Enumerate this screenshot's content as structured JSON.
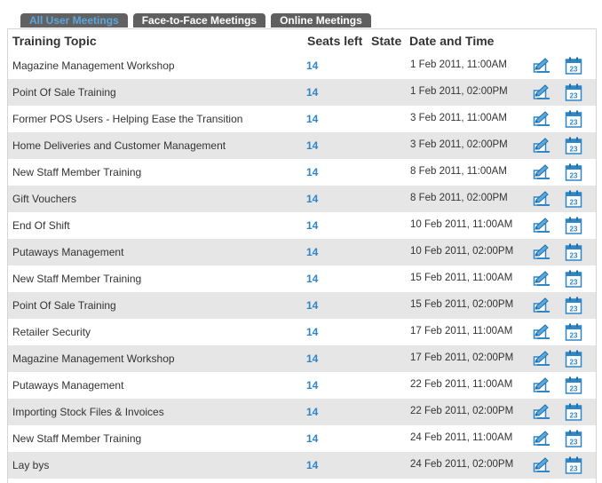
{
  "tabs": [
    {
      "label": "All User Meetings",
      "active": true
    },
    {
      "label": "Face-to-Face Meetings",
      "active": false
    },
    {
      "label": "Online Meetings",
      "active": false
    }
  ],
  "columns": {
    "topic": "Training Topic",
    "seats": "Seats left",
    "state": "State",
    "date": "Date and Time"
  },
  "icons": {
    "edit": "edit-pencil-icon",
    "calendar": "calendar-icon",
    "calendar_day": "23"
  },
  "colors": {
    "accent": "#2f86c6",
    "tab_bg": "#5f5f5f",
    "row_alt": "#e6e6e6"
  },
  "rows": [
    {
      "topic": "Magazine Management Workshop",
      "seats": "14",
      "state": "",
      "date": "1 Feb 2011, 11:00AM"
    },
    {
      "topic": "Point Of Sale Training",
      "seats": "14",
      "state": "",
      "date": "1 Feb 2011, 02:00PM"
    },
    {
      "topic": "Former POS Users - Helping Ease the Transition",
      "seats": "14",
      "state": "",
      "date": "3 Feb 2011, 11:00AM"
    },
    {
      "topic": "Home Deliveries and Customer Management",
      "seats": "14",
      "state": "",
      "date": "3 Feb 2011, 02:00PM"
    },
    {
      "topic": "New Staff Member Training",
      "seats": "14",
      "state": "",
      "date": "8 Feb 2011, 11:00AM"
    },
    {
      "topic": "Gift Vouchers",
      "seats": "14",
      "state": "",
      "date": "8 Feb 2011, 02:00PM"
    },
    {
      "topic": "End Of Shift",
      "seats": "14",
      "state": "",
      "date": "10 Feb 2011, 11:00AM"
    },
    {
      "topic": "Putaways Management",
      "seats": "14",
      "state": "",
      "date": "10 Feb 2011, 02:00PM"
    },
    {
      "topic": "New Staff Member Training",
      "seats": "14",
      "state": "",
      "date": "15 Feb 2011, 11:00AM"
    },
    {
      "topic": "Point Of Sale Training",
      "seats": "14",
      "state": "",
      "date": "15 Feb 2011, 02:00PM"
    },
    {
      "topic": "Retailer Security",
      "seats": "14",
      "state": "",
      "date": "17 Feb 2011, 11:00AM"
    },
    {
      "topic": "Magazine Management Workshop",
      "seats": "14",
      "state": "",
      "date": "17 Feb 2011, 02:00PM"
    },
    {
      "topic": "Putaways Management",
      "seats": "14",
      "state": "",
      "date": "22 Feb 2011, 11:00AM"
    },
    {
      "topic": "Importing Stock Files & Invoices",
      "seats": "14",
      "state": "",
      "date": "22 Feb 2011, 02:00PM"
    },
    {
      "topic": "New Staff Member Training",
      "seats": "14",
      "state": "",
      "date": "24 Feb 2011, 11:00AM"
    },
    {
      "topic": "Lay bys",
      "seats": "14",
      "state": "",
      "date": "24 Feb 2011, 02:00PM"
    }
  ]
}
